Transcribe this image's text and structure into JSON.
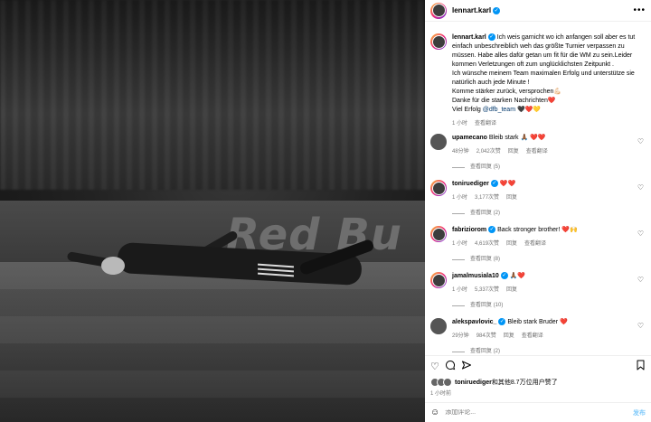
{
  "photo": {
    "board_text": "Red Bu"
  },
  "post": {
    "username": "lennart.karl",
    "verified_mark": "✓",
    "more_icon": "more-horizontal-icon",
    "caption_lines": [
      "Ich weis garnicht wo ich anfangen soll aber es tut einfach unbeschreiblich weh das größte Turnier verpassen zu müssen. Habe alles dafür getan um fit für die WM zu sein.Leider kommen Verletzungen oft zum unglücklichsten Zeitpunkt .",
      "Ich wünsche meinem Team maximalen Erfolg und unterstütze sie natürlich auch jede Minute !",
      "Komme stärker zurück, versprochen💪🏻",
      "Danke für die starken Nachrichten❤️",
      "Viel Erfolg "
    ],
    "caption_mention": "@dfb_team",
    "caption_end": " 🖤❤️💛",
    "time": "1 小时",
    "see_translation": "查看翻译"
  },
  "comments": [
    {
      "username": "upamecano",
      "verified": false,
      "text": "Bleib stark 🙏🏾 ❤️❤️",
      "time": "48分钟",
      "likes": "2,042次赞",
      "reply": "回复",
      "translate": "查看翻译",
      "replies": "查看回复 (5)"
    },
    {
      "username": "toniruediger",
      "verified": true,
      "text": "❤️❤️",
      "time": "1 小时",
      "likes": "3,177次赞",
      "reply": "回复",
      "translate": "",
      "replies": "查看回复 (2)"
    },
    {
      "username": "fabriziorom",
      "verified": true,
      "text": "Back stronger brother! ❤️🙌",
      "time": "1 小时",
      "likes": "4,619次赞",
      "reply": "回复",
      "translate": "查看翻译",
      "replies": "查看回复 (8)"
    },
    {
      "username": "jamalmusiala10",
      "verified": true,
      "text": "🙏🏾❤️",
      "time": "1 小时",
      "likes": "5,337次赞",
      "reply": "回复",
      "translate": "",
      "replies": "查看回复 (10)"
    },
    {
      "username": "alekspavlovic_",
      "verified": true,
      "text": "Bleib stark Bruder ❤️",
      "time": "29分钟",
      "likes": "984次赞",
      "reply": "回复",
      "translate": "查看翻译",
      "replies": "查看回复 (2)"
    }
  ],
  "actions": {
    "like_icon": "heart-icon",
    "comment_icon": "comment-icon",
    "share_icon": "share-icon",
    "save_icon": "bookmark-icon",
    "liked_by_name": "toniruediger",
    "liked_by_rest": "和其他8.7万位用户赞了",
    "time": "1 小时前"
  },
  "add_comment": {
    "emoji_icon": "emoji-icon",
    "placeholder": "添加评论...",
    "post_label": "发布"
  }
}
